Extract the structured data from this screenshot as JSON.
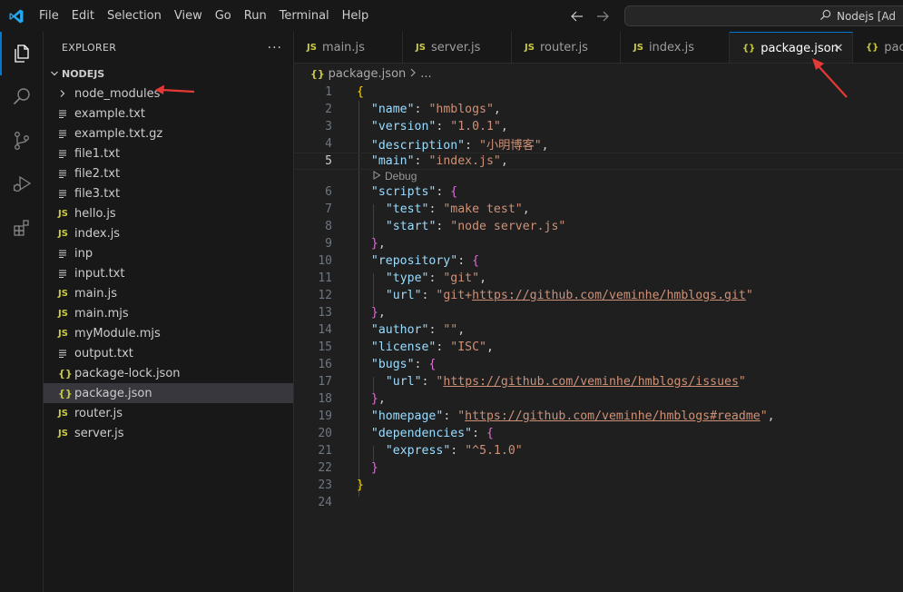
{
  "titlebar": {
    "menu": [
      "File",
      "Edit",
      "Selection",
      "View",
      "Go",
      "Run",
      "Terminal",
      "Help"
    ],
    "command_center": "Nodejs [Ad"
  },
  "sidebar": {
    "header": "EXPLORER",
    "more": "···",
    "folder": "NODEJS",
    "items": [
      {
        "name": "node_modules",
        "type": "folder"
      },
      {
        "name": "example.txt",
        "type": "txt"
      },
      {
        "name": "example.txt.gz",
        "type": "txt"
      },
      {
        "name": "file1.txt",
        "type": "txt"
      },
      {
        "name": "file2.txt",
        "type": "txt"
      },
      {
        "name": "file3.txt",
        "type": "txt"
      },
      {
        "name": "hello.js",
        "type": "js"
      },
      {
        "name": "index.js",
        "type": "js"
      },
      {
        "name": "inp",
        "type": "txt"
      },
      {
        "name": "input.txt",
        "type": "txt"
      },
      {
        "name": "main.js",
        "type": "js"
      },
      {
        "name": "main.mjs",
        "type": "js"
      },
      {
        "name": "myModule.mjs",
        "type": "js"
      },
      {
        "name": "output.txt",
        "type": "txt"
      },
      {
        "name": "package-lock.json",
        "type": "json"
      },
      {
        "name": "package.json",
        "type": "json",
        "selected": true
      },
      {
        "name": "router.js",
        "type": "js"
      },
      {
        "name": "server.js",
        "type": "js"
      }
    ]
  },
  "tabs": [
    {
      "label": "main.js",
      "icon": "JS"
    },
    {
      "label": "server.js",
      "icon": "JS"
    },
    {
      "label": "router.js",
      "icon": "JS"
    },
    {
      "label": "index.js",
      "icon": "JS"
    },
    {
      "label": "package.json",
      "icon": "{}",
      "active": true
    },
    {
      "label": "pack",
      "icon": "{}"
    }
  ],
  "breadcrumb": {
    "file": "package.json",
    "rest": "..."
  },
  "editor": {
    "codelens": "Debug",
    "line_numbers": [
      "1",
      "2",
      "3",
      "4",
      "5",
      "6",
      "7",
      "8",
      "9",
      "10",
      "11",
      "12",
      "13",
      "14",
      "15",
      "16",
      "17",
      "18",
      "19",
      "20",
      "21",
      "22",
      "23",
      "24"
    ],
    "lines": [
      "{",
      "  \"name\": \"hmblogs\",",
      "  \"version\": \"1.0.1\",",
      "  \"description\": \"小明博客\",",
      "  \"main\": \"index.js\",",
      "  \"scripts\": {",
      "    \"test\": \"make test\",",
      "    \"start\": \"node server.js\"",
      "  },",
      "  \"repository\": {",
      "    \"type\": \"git\",",
      "    \"url\": \"git+https://github.com/veminhe/hmblogs.git\"",
      "  },",
      "  \"author\": \"\",",
      "  \"license\": \"ISC\",",
      "  \"bugs\": {",
      "    \"url\": \"https://github.com/veminhe/hmblogs/issues\"",
      "  },",
      "  \"homepage\": \"https://github.com/veminhe/hmblogs#readme\",",
      "  \"dependencies\": {",
      "    \"express\": \"^5.1.0\"",
      "  }",
      "}",
      ""
    ]
  },
  "colors": {
    "accent": "#0078d4",
    "annotation_arrow": "#e53935"
  }
}
